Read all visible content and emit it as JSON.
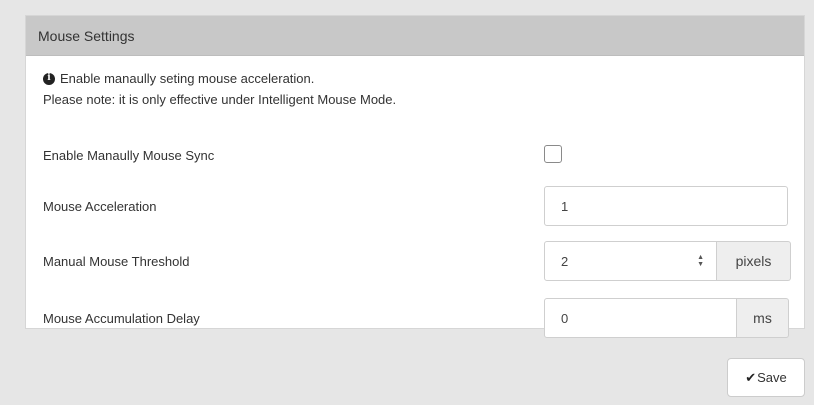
{
  "panel": {
    "title": "Mouse Settings",
    "note_line1": "Enable manaully seting mouse acceleration.",
    "note_line2": "Please note: it is only effective under Intelligent Mouse Mode."
  },
  "fields": {
    "manual_sync": {
      "label": "Enable Manaully Mouse Sync",
      "checked": false
    },
    "acceleration": {
      "label": "Mouse Acceleration",
      "value": "1"
    },
    "threshold": {
      "label": "Manual Mouse Threshold",
      "value": "2",
      "unit": "pixels"
    },
    "accumulation_delay": {
      "label": "Mouse Accumulation Delay",
      "value": "0",
      "unit": "ms"
    }
  },
  "actions": {
    "save_label": "Save"
  },
  "icons": {
    "info": "info-circle-icon",
    "save": "check-icon",
    "spinner": "spinner-updown-icon"
  },
  "colors": {
    "header_bg": "#c8c8c8",
    "page_bg": "#e6e6e6",
    "addon_bg": "#eeeeee"
  }
}
